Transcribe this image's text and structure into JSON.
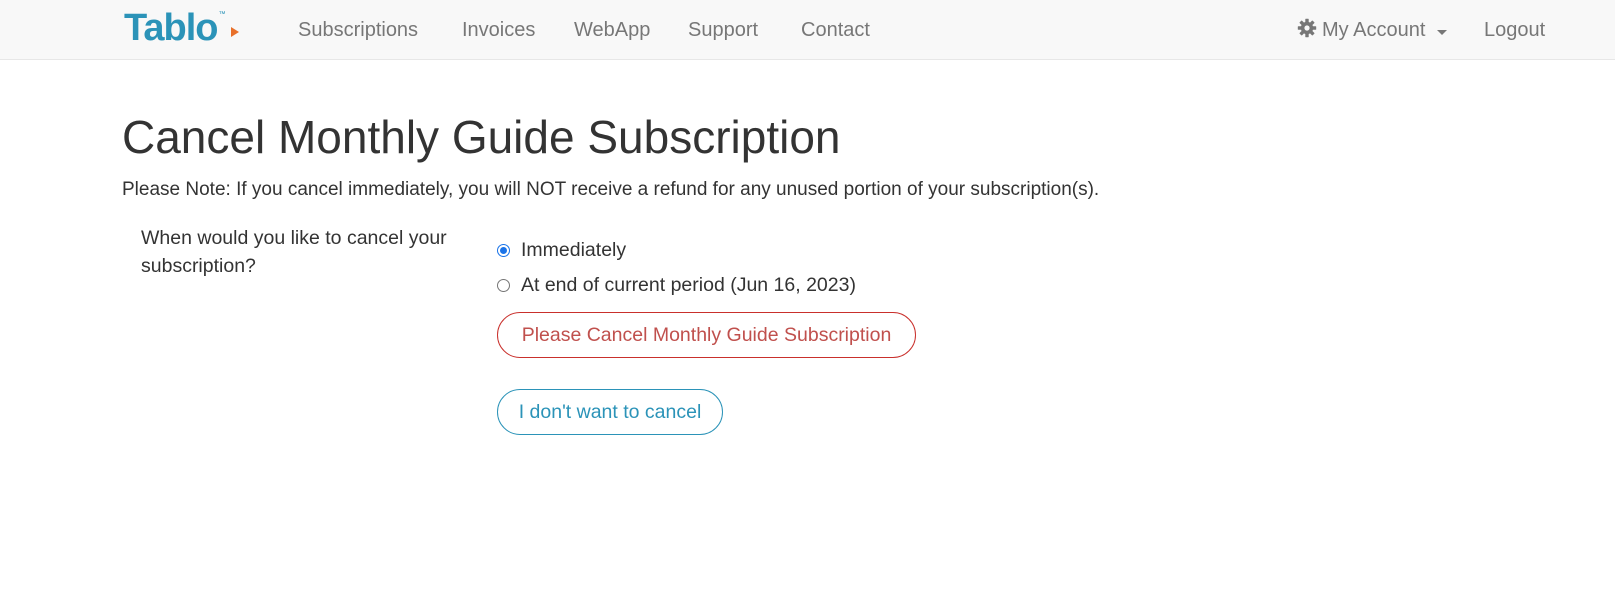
{
  "brand": {
    "name": "Tablo",
    "tm": "™"
  },
  "nav": {
    "links": [
      "Subscriptions",
      "Invoices",
      "WebApp",
      "Support",
      "Contact"
    ],
    "account_label": "My Account",
    "logout_label": "Logout"
  },
  "page": {
    "title": "Cancel Monthly Guide Subscription",
    "note": "Please Note: If you cancel immediately, you will NOT receive a refund for any unused portion of your subscription(s)."
  },
  "form": {
    "question": "When would you like to cancel your subscription?",
    "options": [
      {
        "label": "Immediately",
        "checked": true
      },
      {
        "label": "At end of current period (Jun 16, 2023)",
        "checked": false
      }
    ],
    "confirm_label": "Please Cancel Monthly Guide Subscription",
    "keep_label": "I don't want to cancel"
  },
  "colors": {
    "brand_blue": "#2b93b8",
    "brand_orange": "#e8702a",
    "danger": "#c9302c",
    "nav_text": "#777777",
    "radio_accent": "#1a73e8"
  }
}
